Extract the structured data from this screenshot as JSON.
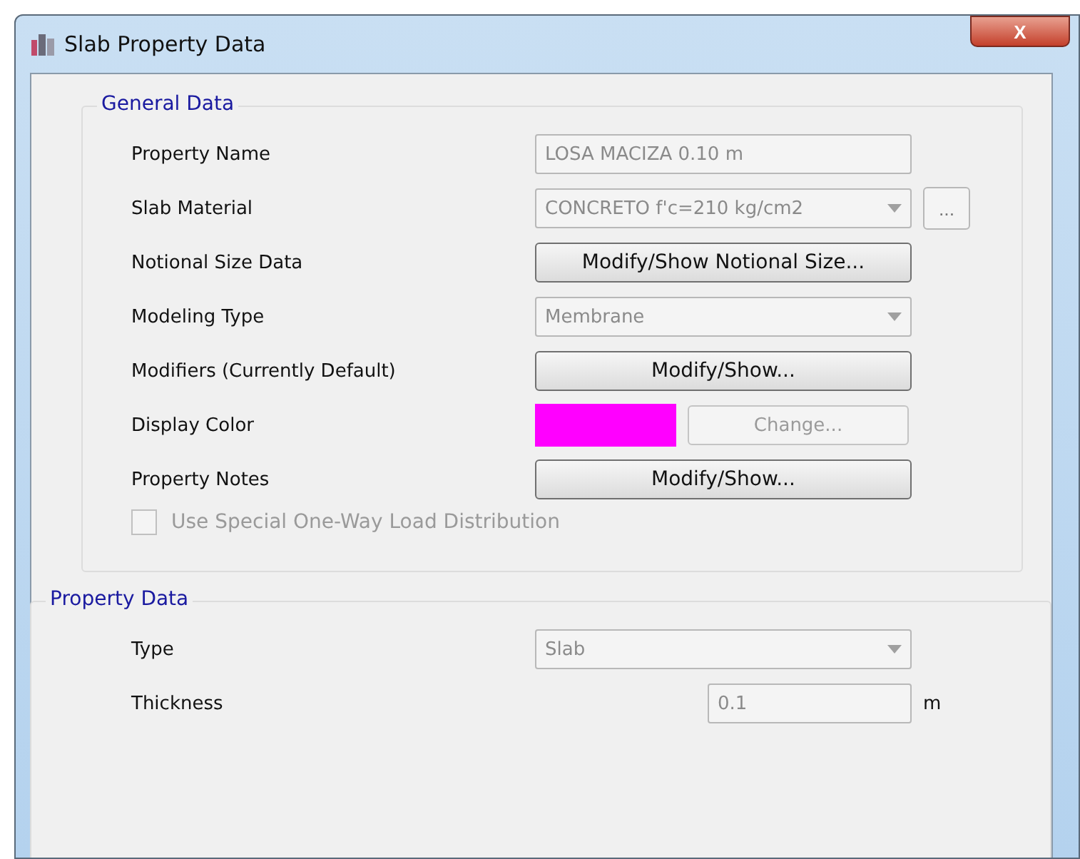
{
  "window": {
    "title": "Slab Property Data",
    "close": "X"
  },
  "general_data": {
    "title": "General Data",
    "rows": [
      {
        "label": "Property Name",
        "kind": "text",
        "value": "LOSA MACIZA 0.10 m",
        "disabled": true
      },
      {
        "label": "Slab Material",
        "kind": "dropdown",
        "value": "CONCRETO f'c=210 kg/cm2",
        "disabled": true,
        "extra_button": "..."
      },
      {
        "label": "Notional Size Data",
        "kind": "button",
        "value": "Modify/Show Notional Size...",
        "disabled": false
      },
      {
        "label": "Modeling Type",
        "kind": "dropdown",
        "value": "Membrane",
        "disabled": true
      },
      {
        "label": "Modifiers (Currently Default)",
        "kind": "button",
        "value": "Modify/Show...",
        "disabled": false
      },
      {
        "label": "Display Color",
        "kind": "color",
        "color": "#ff00ff",
        "value": "Change...",
        "disabled": true
      },
      {
        "label": "Property Notes",
        "kind": "button",
        "value": "Modify/Show...",
        "disabled": false
      }
    ],
    "checkbox": {
      "label": "Use Special One-Way Load Distribution",
      "checked": false,
      "disabled": true
    }
  },
  "property_data": {
    "title": "Property Data",
    "rows": [
      {
        "label": "Type",
        "kind": "dropdown",
        "value": "Slab",
        "disabled": true
      },
      {
        "label": "Thickness",
        "kind": "number",
        "value": "0.1",
        "unit": "m",
        "disabled": true
      }
    ]
  }
}
